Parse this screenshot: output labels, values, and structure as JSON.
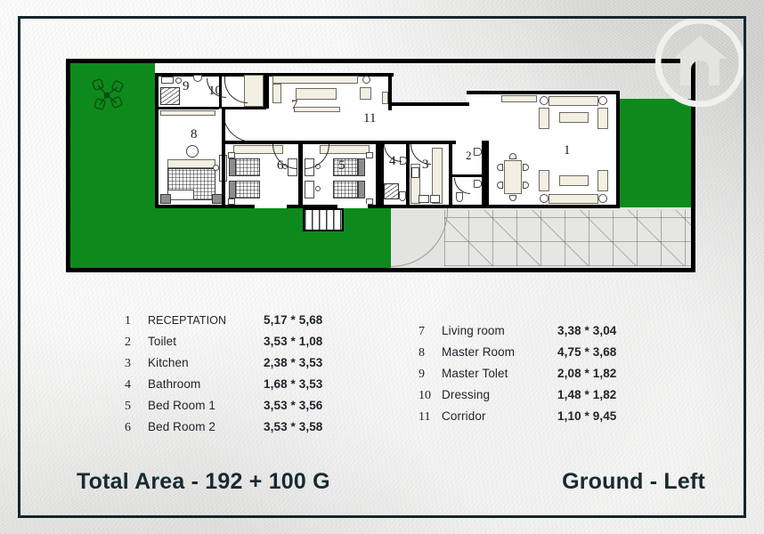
{
  "logo": {
    "icon": "house-in-circle-logo",
    "color": "#e7e7e5"
  },
  "colors": {
    "grass": "#0e8a1c",
    "wall": "#000000",
    "paper": "#e2e2e0",
    "frame": "#16262b",
    "text": "#20252b"
  },
  "plan": {
    "title": "ground-floor-left-plan",
    "room_markers": [
      {
        "id": "1",
        "label": "1",
        "room": "Receptation"
      },
      {
        "id": "2",
        "label": "2",
        "room": "Toilet"
      },
      {
        "id": "3",
        "label": "3",
        "room": "Kitchen"
      },
      {
        "id": "4",
        "label": "4",
        "room": "Bathroom"
      },
      {
        "id": "5",
        "label": "5",
        "room": "Bed Room 1"
      },
      {
        "id": "6",
        "label": "6",
        "room": "Bed Room 2"
      },
      {
        "id": "7",
        "label": "7",
        "room": "Living room"
      },
      {
        "id": "8",
        "label": "8",
        "room": "Master Room"
      },
      {
        "id": "9",
        "label": "9",
        "room": "Master Tolet"
      },
      {
        "id": "10",
        "label": "10",
        "room": "Dressing"
      },
      {
        "id": "11",
        "label": "11",
        "room": "Corridor"
      }
    ]
  },
  "legend": {
    "left_column": [
      {
        "num": "1",
        "name": "RECEPTATION",
        "dim": "5,17 * 5,68"
      },
      {
        "num": "2",
        "name": "Toilet",
        "dim": "3,53 * 1,08"
      },
      {
        "num": "3",
        "name": "Kitchen",
        "dim": "2,38 * 3,53"
      },
      {
        "num": "4",
        "name": "Bathroom",
        "dim": "1,68 * 3,53"
      },
      {
        "num": "5",
        "name": "Bed Room 1",
        "dim": "3,53 * 3,56"
      },
      {
        "num": "6",
        "name": "Bed Room 2",
        "dim": "3,53 * 3,58"
      }
    ],
    "right_column": [
      {
        "num": "7",
        "name": "Living room",
        "dim": "3,38 * 3,04"
      },
      {
        "num": "8",
        "name": "Master Room",
        "dim": "4,75 * 3,68"
      },
      {
        "num": "9",
        "name": "Master Tolet",
        "dim": "2,08 * 1,82"
      },
      {
        "num": "10",
        "name": "Dressing",
        "dim": "1,48 * 1,82"
      },
      {
        "num": "11",
        "name": "Corridor",
        "dim": "1,10 * 9,45"
      }
    ]
  },
  "footer": {
    "total_area": "Total Area - 192 + 100 G",
    "floor_label": "Ground - Left"
  }
}
